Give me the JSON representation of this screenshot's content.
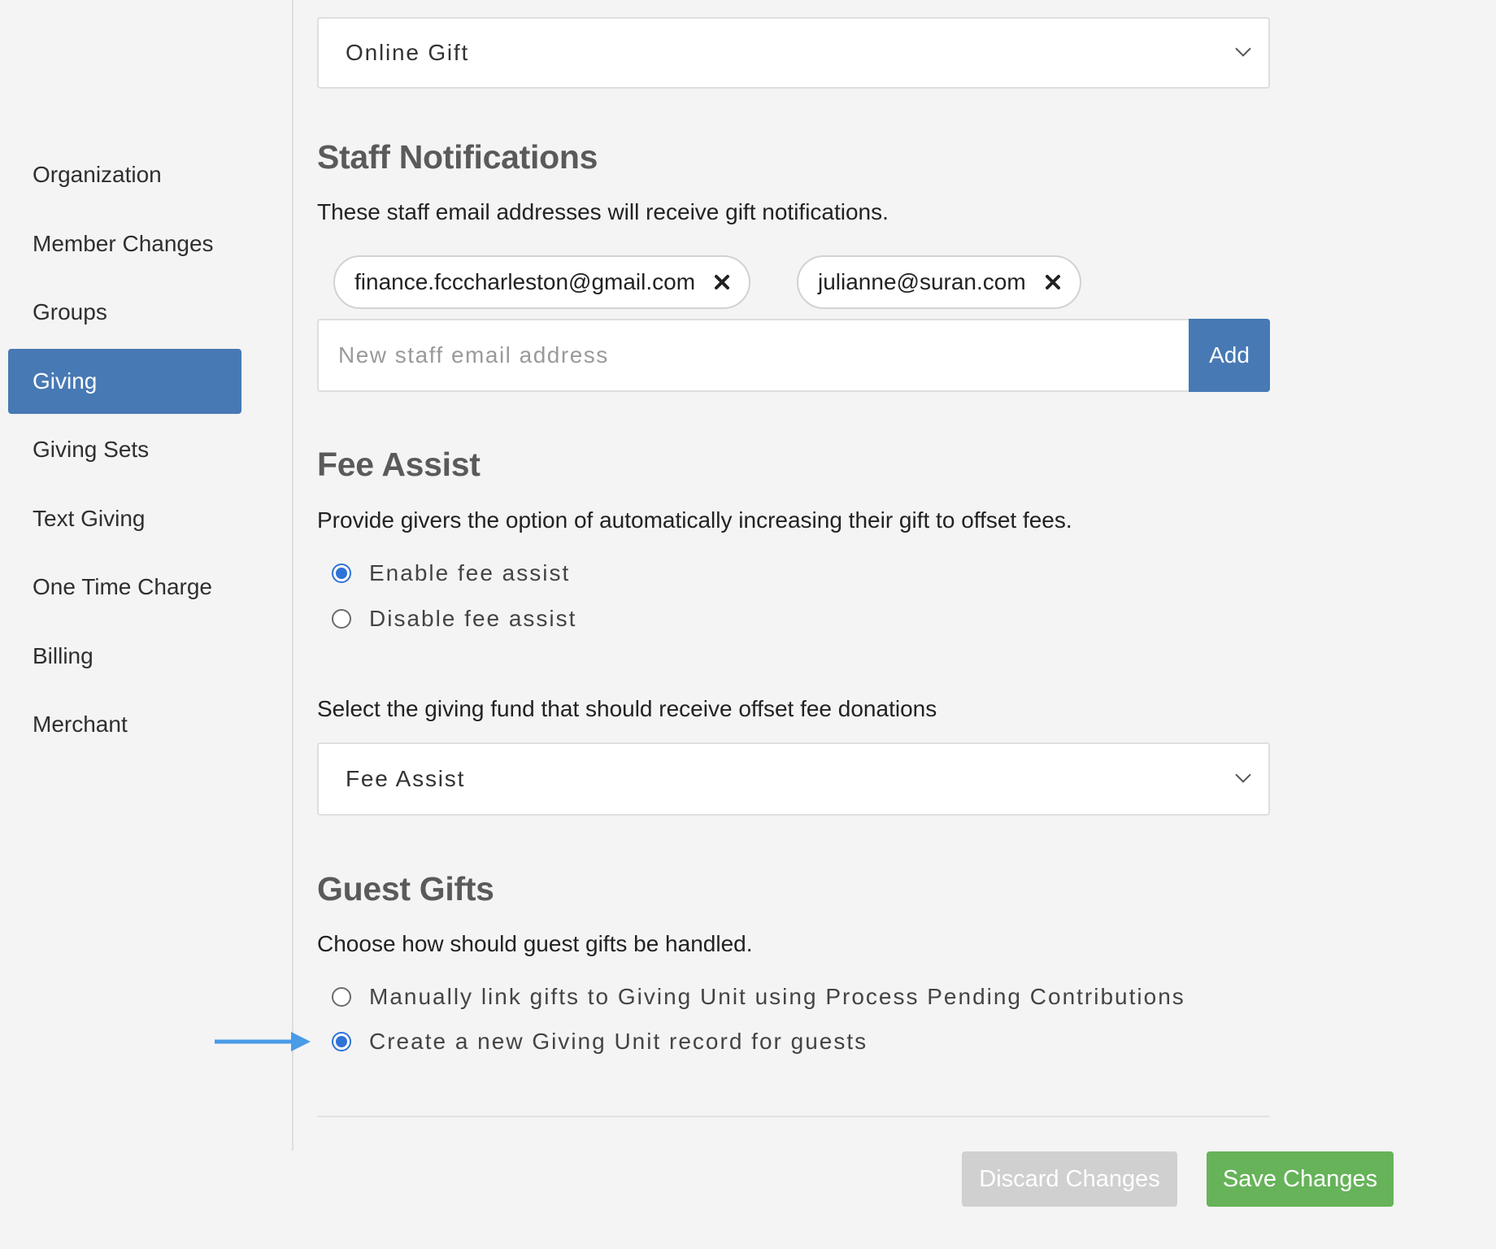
{
  "sidebar": {
    "items": [
      {
        "label": "Organization"
      },
      {
        "label": "Member Changes"
      },
      {
        "label": "Groups"
      },
      {
        "label": "Giving",
        "active": true
      },
      {
        "label": "Giving Sets"
      },
      {
        "label": "Text Giving"
      },
      {
        "label": "One Time Charge"
      },
      {
        "label": "Billing"
      },
      {
        "label": "Merchant"
      }
    ]
  },
  "top_select": {
    "value": "Online Gift"
  },
  "staff_notifications": {
    "title": "Staff Notifications",
    "description": "These staff email addresses will receive gift notifications.",
    "emails": [
      "finance.fcccharleston@gmail.com",
      "julianne@suran.com"
    ],
    "input_placeholder": "New staff email address",
    "add_label": "Add"
  },
  "fee_assist": {
    "title": "Fee Assist",
    "description": "Provide givers the option of automatically increasing their gift to offset fees.",
    "options": [
      {
        "label": "Enable fee assist",
        "checked": true
      },
      {
        "label": "Disable fee assist",
        "checked": false
      }
    ],
    "fund_prompt": "Select the giving fund that should receive offset fee donations",
    "fund_select": {
      "value": "Fee Assist"
    }
  },
  "guest_gifts": {
    "title": "Guest Gifts",
    "description": "Choose how should guest gifts be handled.",
    "options": [
      {
        "label": "Manually link gifts to Giving Unit using Process Pending Contributions",
        "checked": false
      },
      {
        "label": "Create a new Giving Unit record for guests",
        "checked": true
      }
    ]
  },
  "actions": {
    "discard_label": "Discard Changes",
    "save_label": "Save Changes"
  },
  "colors": {
    "accent": "#4779b4",
    "radio_checked": "#2f72d8",
    "save": "#66b35a",
    "discard": "#d0d0d0",
    "annotation_arrow": "#4a9be8"
  }
}
